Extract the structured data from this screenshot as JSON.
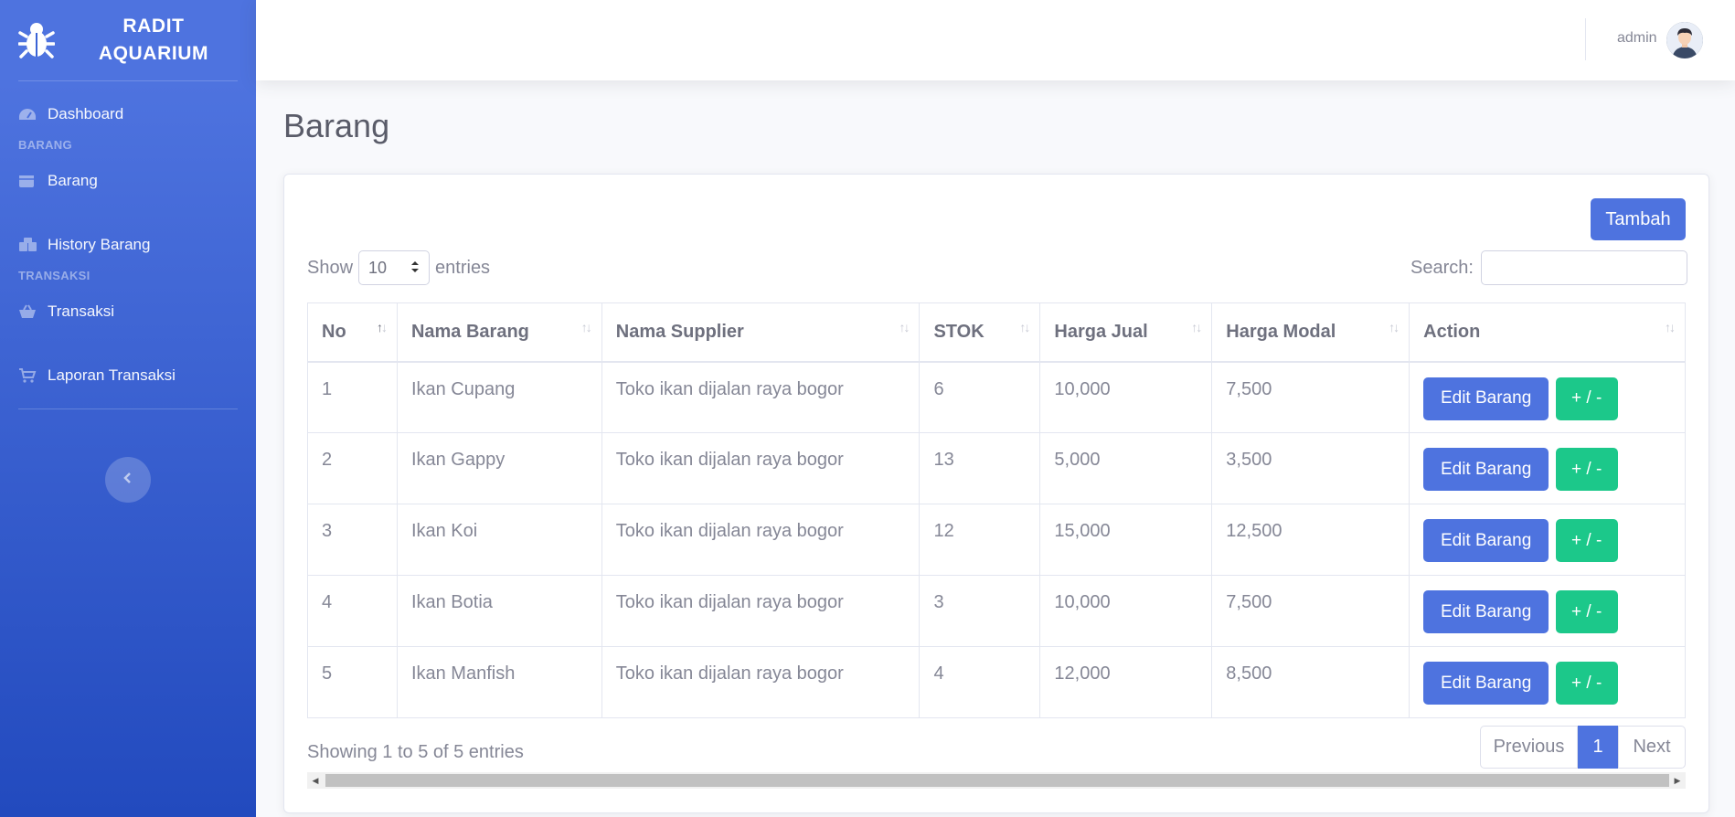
{
  "sidebar": {
    "brand_line1": "RADIT",
    "brand_line2": "AQUARIUM",
    "items": {
      "dashboard": "Dashboard",
      "barang": "Barang",
      "history": "History Barang",
      "transaksi": "Transaksi",
      "laporan": "Laporan Transaksi"
    },
    "headings": {
      "barang": "BARANG",
      "transaksi": "TRANSAKSI"
    }
  },
  "topbar": {
    "user": "admin"
  },
  "page": {
    "title": "Barang"
  },
  "actions": {
    "tambah": "Tambah"
  },
  "table_controls": {
    "show_label": "Show",
    "entries_value": "10",
    "entries_label": "entries",
    "search_label": "Search:",
    "search_value": ""
  },
  "table": {
    "columns": [
      "No",
      "Nama Barang",
      "Nama Supplier",
      "STOK",
      "Harga Jual",
      "Harga Modal",
      "Action"
    ],
    "rows": [
      {
        "no": "1",
        "nama": "Ikan Cupang",
        "supplier": "Toko ikan dijalan raya bogor",
        "stok": "6",
        "jual": "10,000",
        "modal": "7,500"
      },
      {
        "no": "2",
        "nama": "Ikan Gappy",
        "supplier": "Toko ikan dijalan raya bogor",
        "stok": "13",
        "jual": "5,000",
        "modal": "3,500"
      },
      {
        "no": "3",
        "nama": "Ikan Koi",
        "supplier": "Toko ikan dijalan raya bogor",
        "stok": "12",
        "jual": "15,000",
        "modal": "12,500"
      },
      {
        "no": "4",
        "nama": "Ikan Botia",
        "supplier": "Toko ikan dijalan raya bogor",
        "stok": "3",
        "jual": "10,000",
        "modal": "7,500"
      },
      {
        "no": "5",
        "nama": "Ikan Manfish",
        "supplier": "Toko ikan dijalan raya bogor",
        "stok": "4",
        "jual": "12,000",
        "modal": "8,500"
      }
    ],
    "edit_label": "Edit Barang",
    "adjust_label": "+ / -"
  },
  "footer": {
    "info": "Showing 1 to 5 of 5 entries",
    "previous": "Previous",
    "current_page": "1",
    "next": "Next"
  },
  "colors": {
    "primary": "#4e73df",
    "success": "#1cc88a",
    "sidebar_dark": "#224abe"
  }
}
